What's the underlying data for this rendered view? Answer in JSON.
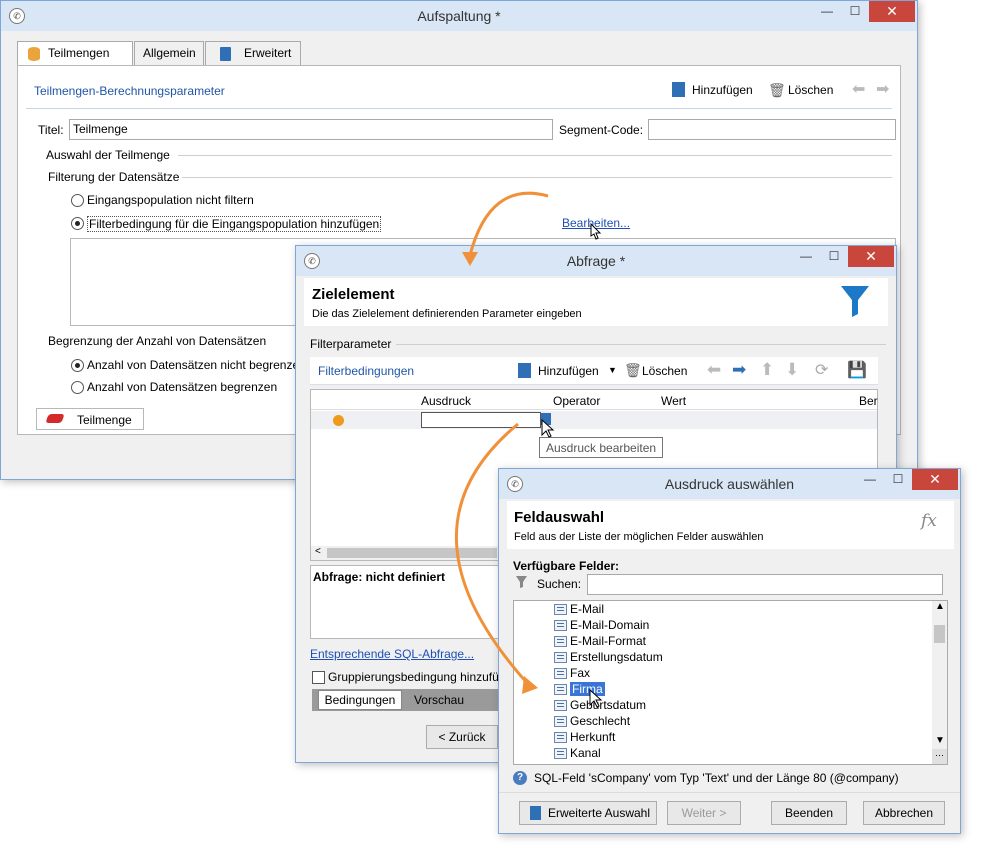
{
  "win1": {
    "title": "Aufspaltung *",
    "tabs": [
      "Teilmengen",
      "Allgemein",
      "Erweitert"
    ],
    "section_title": "Teilmengen-Berechnungsparameter",
    "add_label": "Hinzufügen",
    "delete_label": "Löschen",
    "titel_label": "Titel:",
    "titel_value": "Teilmenge",
    "segment_label": "Segment-Code:",
    "auswahl_group": "Auswahl der Teilmenge",
    "filterung_group": "Filterung der Datensätze",
    "radio1": "Eingangspopulation nicht filtern",
    "radio2": "Filterbedingung für die Eingangspopulation hinzufügen",
    "edit_link": "Bearbeiten...",
    "begrenzung_group": "Begrenzung der Anzahl von Datensätzen",
    "radio3": "Anzahl von Datensätzen nicht begrenzen",
    "radio4": "Anzahl von Datensätzen begrenzen",
    "subset_tab": "Teilmenge"
  },
  "win2": {
    "title": "Abfrage *",
    "heading": "Zielelement",
    "subheading": "Die das Zielelement definierenden Parameter eingeben",
    "filterparam": "Filterparameter",
    "filterbed": "Filterbedingungen",
    "add_label": "Hinzufügen",
    "delete_label": "Löschen",
    "columns": [
      "Ausdruck",
      "Operator",
      "Wert",
      "Ber"
    ],
    "tooltip": "Ausdruck bearbeiten",
    "status": "Abfrage: nicht definiert",
    "sql_link": "Entsprechende SQL-Abfrage...",
    "group_check": "Gruppierungsbedingung hinzufü",
    "tabs": [
      "Bedingungen",
      "Vorschau"
    ],
    "back_btn": "< Zurück"
  },
  "win3": {
    "title": "Ausdruck auswählen",
    "heading": "Feldauswahl",
    "subheading": "Feld aus der Liste der möglichen Felder auswählen",
    "fields_label": "Verfügbare Felder:",
    "search_label": "Suchen:",
    "fields": [
      "E-Mail",
      "E-Mail-Domain",
      "E-Mail-Format",
      "Erstellungsdatum",
      "Fax",
      "Firma",
      "Geburtsdatum",
      "Geschlecht",
      "Herkunft",
      "Kanal"
    ],
    "selected_field": "Firma",
    "info": "SQL-Feld 'sCompany' vom Typ 'Text' und der Länge 80 (@company)",
    "btn_advanced": "Erweiterte Auswahl",
    "btn_next": "Weiter >",
    "btn_finish": "Beenden",
    "btn_cancel": "Abbrechen"
  }
}
